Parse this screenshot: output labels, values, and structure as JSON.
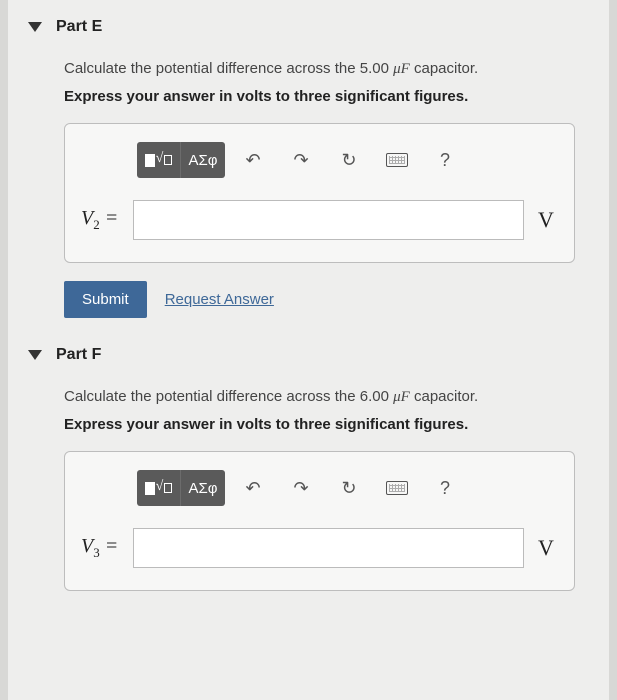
{
  "partE": {
    "title": "Part E",
    "question_pre": "Calculate the potential difference across the 5.00 ",
    "question_unit": "μF",
    "question_post": " capacitor.",
    "instruction": "Express your answer in volts to three significant figures.",
    "var_label": "V",
    "var_sub": "2",
    "equals": " =",
    "unit": "V",
    "submit": "Submit",
    "request": "Request Answer"
  },
  "partF": {
    "title": "Part F",
    "question_pre": "Calculate the potential difference across the 6.00 ",
    "question_unit": "μF",
    "question_post": " capacitor.",
    "instruction": "Express your answer in volts to three significant figures.",
    "var_label": "V",
    "var_sub": "3",
    "equals": " =",
    "unit": "V"
  },
  "toolbar": {
    "greek_btn": "ΑΣφ",
    "help": "?"
  }
}
